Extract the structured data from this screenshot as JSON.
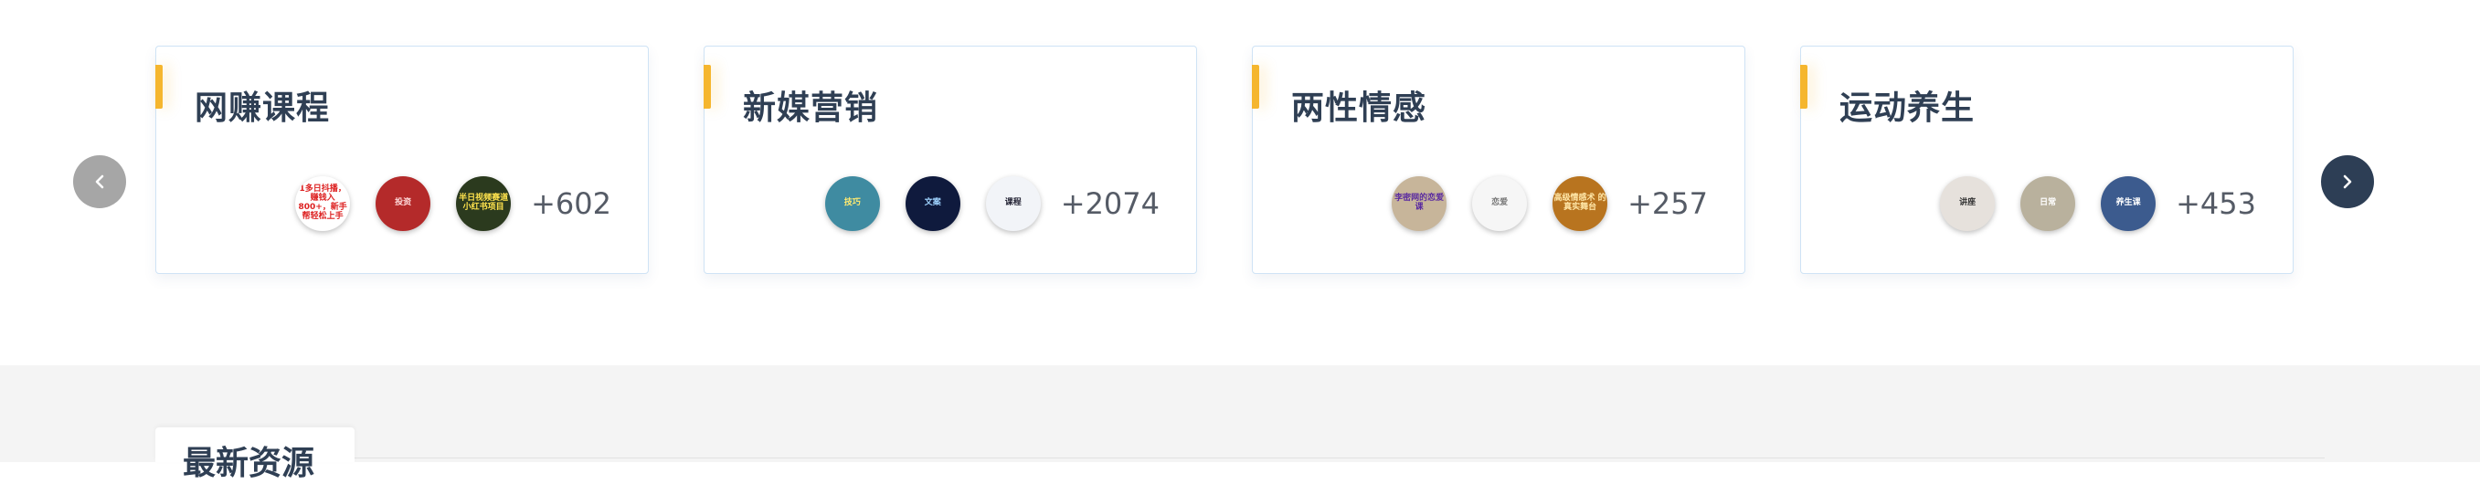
{
  "categories": [
    {
      "title": "网赚课程",
      "count": "+602",
      "thumbs": [
        {
          "bg": "#ffffff",
          "fg": "#d22",
          "text": "1多日抖播，赚钱入800+，新手帮轻松上手"
        },
        {
          "bg": "#b42a2a",
          "fg": "#ffd9d9",
          "text": "投资"
        },
        {
          "bg": "#2b3a1e",
          "fg": "#ffe34d",
          "text": "半日视频赛道 小红书项目"
        }
      ]
    },
    {
      "title": "新媒营销",
      "count": "+2074",
      "thumbs": [
        {
          "bg": "#3f8ba1",
          "fg": "#ffea70",
          "text": "技巧"
        },
        {
          "bg": "#0f1a3d",
          "fg": "#9fd3ff",
          "text": "文案"
        },
        {
          "bg": "#f2f4f8",
          "fg": "#223",
          "text": "课程"
        }
      ]
    },
    {
      "title": "两性情感",
      "count": "+257",
      "thumbs": [
        {
          "bg": "#c7b59a",
          "fg": "#5a2aa0",
          "text": "李密网的恋爱课"
        },
        {
          "bg": "#f6f6f6",
          "fg": "#777",
          "text": "恋爱"
        },
        {
          "bg": "#b8741f",
          "fg": "#ffe7a8",
          "text": "高级情感术 的真实舞台"
        }
      ]
    },
    {
      "title": "运动养生",
      "count": "+453",
      "thumbs": [
        {
          "bg": "#e6e1dc",
          "fg": "#333",
          "text": "讲座"
        },
        {
          "bg": "#b9b19d",
          "fg": "#fff",
          "text": "日常"
        },
        {
          "bg": "#3c5b8e",
          "fg": "#fff",
          "text": "养生课"
        }
      ]
    }
  ],
  "section": {
    "title": "最新资源"
  },
  "colors": {
    "accent": "#f5b62e",
    "title": "#2f3f54",
    "next_button": "#2d3e55",
    "prev_button": "#a6a6a6"
  },
  "icons": {
    "prev": "chevron-left-icon",
    "next": "chevron-right-icon"
  }
}
